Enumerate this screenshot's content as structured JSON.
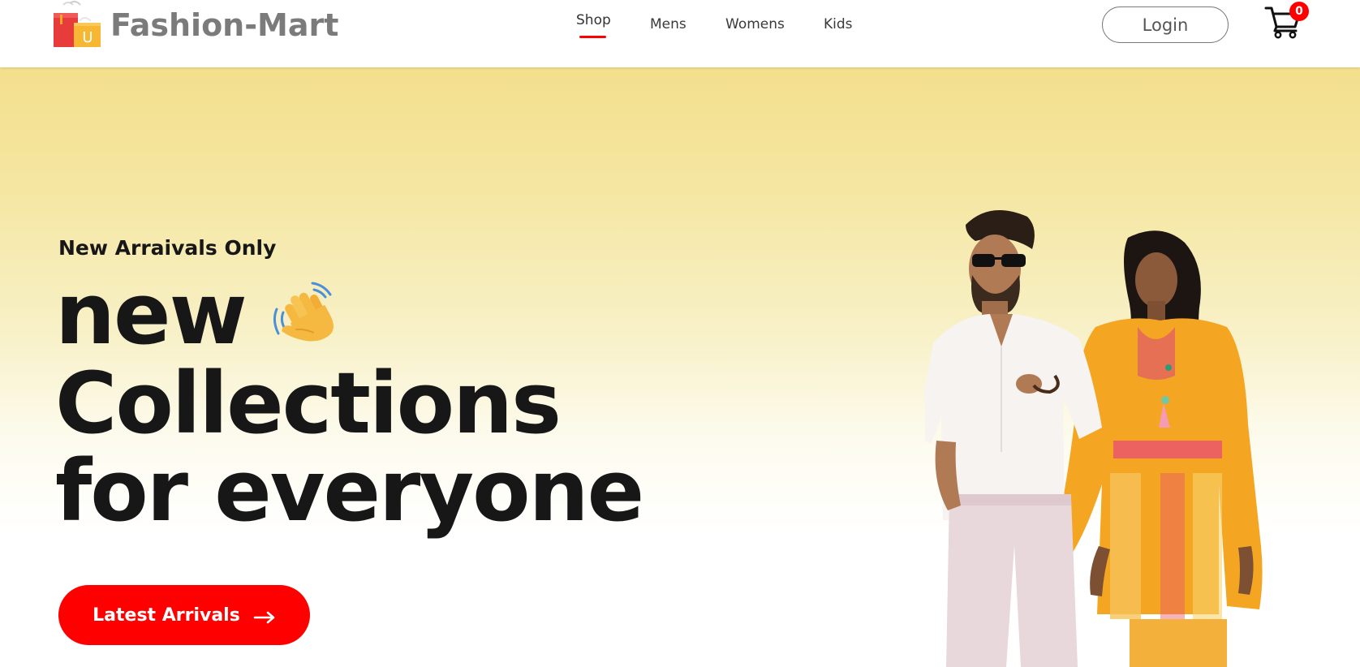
{
  "brand": {
    "name": "Fashion-Mart",
    "logo_letter": "U",
    "logo_icon": "shopping-bags-icon"
  },
  "nav": {
    "items": [
      {
        "label": "Shop",
        "active": true
      },
      {
        "label": "Mens"
      },
      {
        "label": "Womens"
      },
      {
        "label": "Kids"
      }
    ],
    "login_label": "Login",
    "cart_count": "0",
    "cart_icon": "cart-icon"
  },
  "hero": {
    "subtitle": "New Arraivals Only",
    "headline": [
      "new",
      "Collections",
      "for everyone"
    ],
    "wave_icon": "waving-hand-icon",
    "cta_label": "Latest Arrivals",
    "cta_icon": "arrow-right-icon",
    "image_alt": "man in white shirt and woman in orange printed kurta"
  },
  "colors": {
    "accent": "#ff0000",
    "brand_text": "#7b7b7b",
    "hero_top": "#f3df8c",
    "text_dark": "#171717"
  }
}
